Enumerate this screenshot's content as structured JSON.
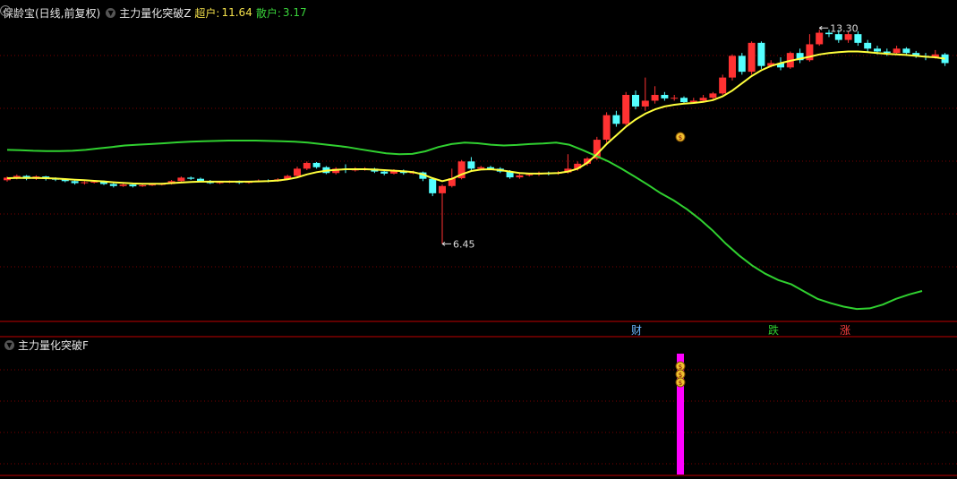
{
  "header": {
    "stock": "保龄宝(日线,前复权)",
    "indicator": "主力量化突破Z",
    "chaohu_label": "超户:",
    "chaohu_value": "11.64",
    "sanhu_label": "散户:",
    "sanhu_value": "3.17"
  },
  "sub_panel": {
    "title": "主力量化突破F"
  },
  "annotations": {
    "high_price": "13.30",
    "low_price": "6.45",
    "tag_cai": "财",
    "tag_die": "跌",
    "tag_zhang": "涨"
  },
  "colors": {
    "up": "#ff3232",
    "down": "#54ffff",
    "ma_line": "#ffff3c",
    "green_line": "#30d030",
    "signal_bar": "#ff00ff",
    "grid": "#7a0000"
  },
  "chart_data": {
    "type": "candlestick",
    "price_range": [
      3.8,
      14.2
    ],
    "candles": [
      [
        8.65,
        8.74,
        8.78,
        8.6
      ],
      [
        8.72,
        8.8,
        8.85,
        8.68
      ],
      [
        8.8,
        8.7,
        8.83,
        8.65
      ],
      [
        8.7,
        8.78,
        8.82,
        8.66
      ],
      [
        8.78,
        8.7,
        8.8,
        8.64
      ],
      [
        8.7,
        8.68,
        8.75,
        8.62
      ],
      [
        8.68,
        8.62,
        8.72,
        8.58
      ],
      [
        8.62,
        8.55,
        8.66,
        8.5
      ],
      [
        8.55,
        8.58,
        8.62,
        8.5
      ],
      [
        8.58,
        8.6,
        8.63,
        8.54
      ],
      [
        8.6,
        8.52,
        8.64,
        8.48
      ],
      [
        8.52,
        8.45,
        8.56,
        8.4
      ],
      [
        8.45,
        8.5,
        8.54,
        8.42
      ],
      [
        8.5,
        8.44,
        8.53,
        8.4
      ],
      [
        8.44,
        8.48,
        8.52,
        8.42
      ],
      [
        8.48,
        8.5,
        8.54,
        8.45
      ],
      [
        8.5,
        8.52,
        8.56,
        8.47
      ],
      [
        8.52,
        8.62,
        8.66,
        8.5
      ],
      [
        8.62,
        8.74,
        8.78,
        8.6
      ],
      [
        8.74,
        8.7,
        8.78,
        8.66
      ],
      [
        8.7,
        8.62,
        8.74,
        8.58
      ],
      [
        8.62,
        8.55,
        8.66,
        8.52
      ],
      [
        8.55,
        8.58,
        8.62,
        8.52
      ],
      [
        8.58,
        8.6,
        8.64,
        8.55
      ],
      [
        8.6,
        8.56,
        8.64,
        8.52
      ],
      [
        8.56,
        8.6,
        8.63,
        8.53
      ],
      [
        8.6,
        8.64,
        8.68,
        8.58
      ],
      [
        8.64,
        8.62,
        8.68,
        8.58
      ],
      [
        8.62,
        8.68,
        8.72,
        8.6
      ],
      [
        8.68,
        8.8,
        8.84,
        8.66
      ],
      [
        8.8,
        9.05,
        9.12,
        8.78
      ],
      [
        9.05,
        9.25,
        9.3,
        9.0
      ],
      [
        9.25,
        9.1,
        9.28,
        9.05
      ],
      [
        9.1,
        8.9,
        9.14,
        8.86
      ],
      [
        8.9,
        9.05,
        9.1,
        8.85
      ],
      [
        9.05,
        9.0,
        9.2,
        8.9
      ],
      [
        9.0,
        9.02,
        9.1,
        8.95
      ],
      [
        9.02,
        9.05,
        9.1,
        8.98
      ],
      [
        9.05,
        8.95,
        9.08,
        8.9
      ],
      [
        8.95,
        8.88,
        9.0,
        8.82
      ],
      [
        8.88,
        8.98,
        9.03,
        8.85
      ],
      [
        8.98,
        8.9,
        9.02,
        8.84
      ],
      [
        8.9,
        8.92,
        8.98,
        8.86
      ],
      [
        8.92,
        8.7,
        8.95,
        8.62
      ],
      [
        8.7,
        8.2,
        8.75,
        8.1
      ],
      [
        8.2,
        8.45,
        8.5,
        6.45
      ],
      [
        8.45,
        8.72,
        9.05,
        8.4
      ],
      [
        8.72,
        9.3,
        9.35,
        8.68
      ],
      [
        9.3,
        9.05,
        9.45,
        9.0
      ],
      [
        9.05,
        9.1,
        9.15,
        9.0
      ],
      [
        9.1,
        9.05,
        9.15,
        9.0
      ],
      [
        9.05,
        8.95,
        9.1,
        8.9
      ],
      [
        8.95,
        8.75,
        9.0,
        8.7
      ],
      [
        8.75,
        8.82,
        8.88,
        8.7
      ],
      [
        8.82,
        8.85,
        8.9,
        8.78
      ],
      [
        8.85,
        8.9,
        8.95,
        8.8
      ],
      [
        8.9,
        8.88,
        8.95,
        8.82
      ],
      [
        8.88,
        8.92,
        8.97,
        8.84
      ],
      [
        8.92,
        9.05,
        9.55,
        8.88
      ],
      [
        9.05,
        9.22,
        9.3,
        8.98
      ],
      [
        9.22,
        9.4,
        9.45,
        9.15
      ],
      [
        9.4,
        10.05,
        10.15,
        9.35
      ],
      [
        10.05,
        10.9,
        11.0,
        9.95
      ],
      [
        10.9,
        10.6,
        11.05,
        10.5
      ],
      [
        10.6,
        11.6,
        11.7,
        10.55
      ],
      [
        11.6,
        11.2,
        11.75,
        11.1
      ],
      [
        11.2,
        11.4,
        12.2,
        11.05
      ],
      [
        11.4,
        11.6,
        11.9,
        11.3
      ],
      [
        11.6,
        11.48,
        11.7,
        11.4
      ],
      [
        11.48,
        11.5,
        11.6,
        11.4
      ],
      [
        11.5,
        11.35,
        11.55,
        11.3
      ],
      [
        11.35,
        11.4,
        11.5,
        11.3
      ],
      [
        11.4,
        11.5,
        11.6,
        11.35
      ],
      [
        11.5,
        11.65,
        11.7,
        11.4
      ],
      [
        11.65,
        12.2,
        12.3,
        11.6
      ],
      [
        12.2,
        12.95,
        13.0,
        12.1
      ],
      [
        12.95,
        12.4,
        13.05,
        12.3
      ],
      [
        12.4,
        13.4,
        13.45,
        12.3
      ],
      [
        13.4,
        12.6,
        13.45,
        12.5
      ],
      [
        12.6,
        12.7,
        12.8,
        12.55
      ],
      [
        12.7,
        12.55,
        12.9,
        12.45
      ],
      [
        12.55,
        13.05,
        13.1,
        12.5
      ],
      [
        13.05,
        12.8,
        13.2,
        12.7
      ],
      [
        12.8,
        13.35,
        13.7,
        12.75
      ],
      [
        13.35,
        13.75,
        13.85,
        13.3
      ],
      [
        13.75,
        13.7,
        13.85,
        13.6
      ],
      [
        13.7,
        13.5,
        13.85,
        13.4
      ],
      [
        13.5,
        13.7,
        13.8,
        13.4
      ],
      [
        13.7,
        13.4,
        13.8,
        13.3
      ],
      [
        13.4,
        13.2,
        13.5,
        13.1
      ],
      [
        13.2,
        13.1,
        13.3,
        13.0
      ],
      [
        13.1,
        13.05,
        13.2,
        12.95
      ],
      [
        13.05,
        13.2,
        13.3,
        13.0
      ],
      [
        13.2,
        13.05,
        13.25,
        12.95
      ],
      [
        13.05,
        12.95,
        13.12,
        12.88
      ],
      [
        12.95,
        12.9,
        13.05,
        12.8
      ],
      [
        12.9,
        13.0,
        13.15,
        12.85
      ],
      [
        13.0,
        12.7,
        13.05,
        12.6
      ]
    ],
    "ma_yellow": [
      8.72,
      8.73,
      8.73,
      8.73,
      8.72,
      8.71,
      8.69,
      8.67,
      8.65,
      8.63,
      8.61,
      8.58,
      8.56,
      8.54,
      8.53,
      8.53,
      8.53,
      8.55,
      8.57,
      8.59,
      8.6,
      8.6,
      8.6,
      8.6,
      8.6,
      8.6,
      8.61,
      8.62,
      8.64,
      8.68,
      8.75,
      8.85,
      8.93,
      8.98,
      9.01,
      9.03,
      9.03,
      9.03,
      9.02,
      9.0,
      8.98,
      8.96,
      8.93,
      8.85,
      8.72,
      8.62,
      8.7,
      8.85,
      8.97,
      9.02,
      9.03,
      9.0,
      8.95,
      8.9,
      8.88,
      8.88,
      8.89,
      8.9,
      8.95,
      9.05,
      9.25,
      9.55,
      9.9,
      10.2,
      10.5,
      10.75,
      10.95,
      11.1,
      11.2,
      11.26,
      11.3,
      11.32,
      11.36,
      11.42,
      11.55,
      11.75,
      12.0,
      12.25,
      12.45,
      12.6,
      12.7,
      12.78,
      12.85,
      12.92,
      13.0,
      13.05,
      13.08,
      13.1,
      13.1,
      13.08,
      13.05,
      13.02,
      13.0,
      12.98,
      12.95,
      12.92,
      12.9,
      12.85
    ],
    "green_line": [
      9.7,
      9.69,
      9.67,
      9.66,
      9.66,
      9.67,
      9.7,
      9.75,
      9.8,
      9.85,
      9.88,
      9.9,
      9.93,
      9.96,
      9.98,
      10.0,
      10.01,
      10.02,
      10.02,
      10.02,
      10.01,
      10.0,
      9.98,
      9.95,
      9.9,
      9.85,
      9.8,
      9.72,
      9.65,
      9.58,
      9.55,
      9.56,
      9.65,
      9.8,
      9.9,
      9.95,
      9.93,
      9.88,
      9.85,
      9.87,
      9.9,
      9.92,
      9.95,
      9.88,
      9.7,
      9.5,
      9.3,
      9.05,
      8.78,
      8.5,
      8.2,
      7.95,
      7.65,
      7.3,
      6.9,
      6.45,
      6.05,
      5.7,
      5.42,
      5.2,
      5.05,
      4.8,
      4.55,
      4.4,
      4.28,
      4.2,
      4.22,
      4.35,
      4.55,
      4.7,
      4.82
    ]
  }
}
